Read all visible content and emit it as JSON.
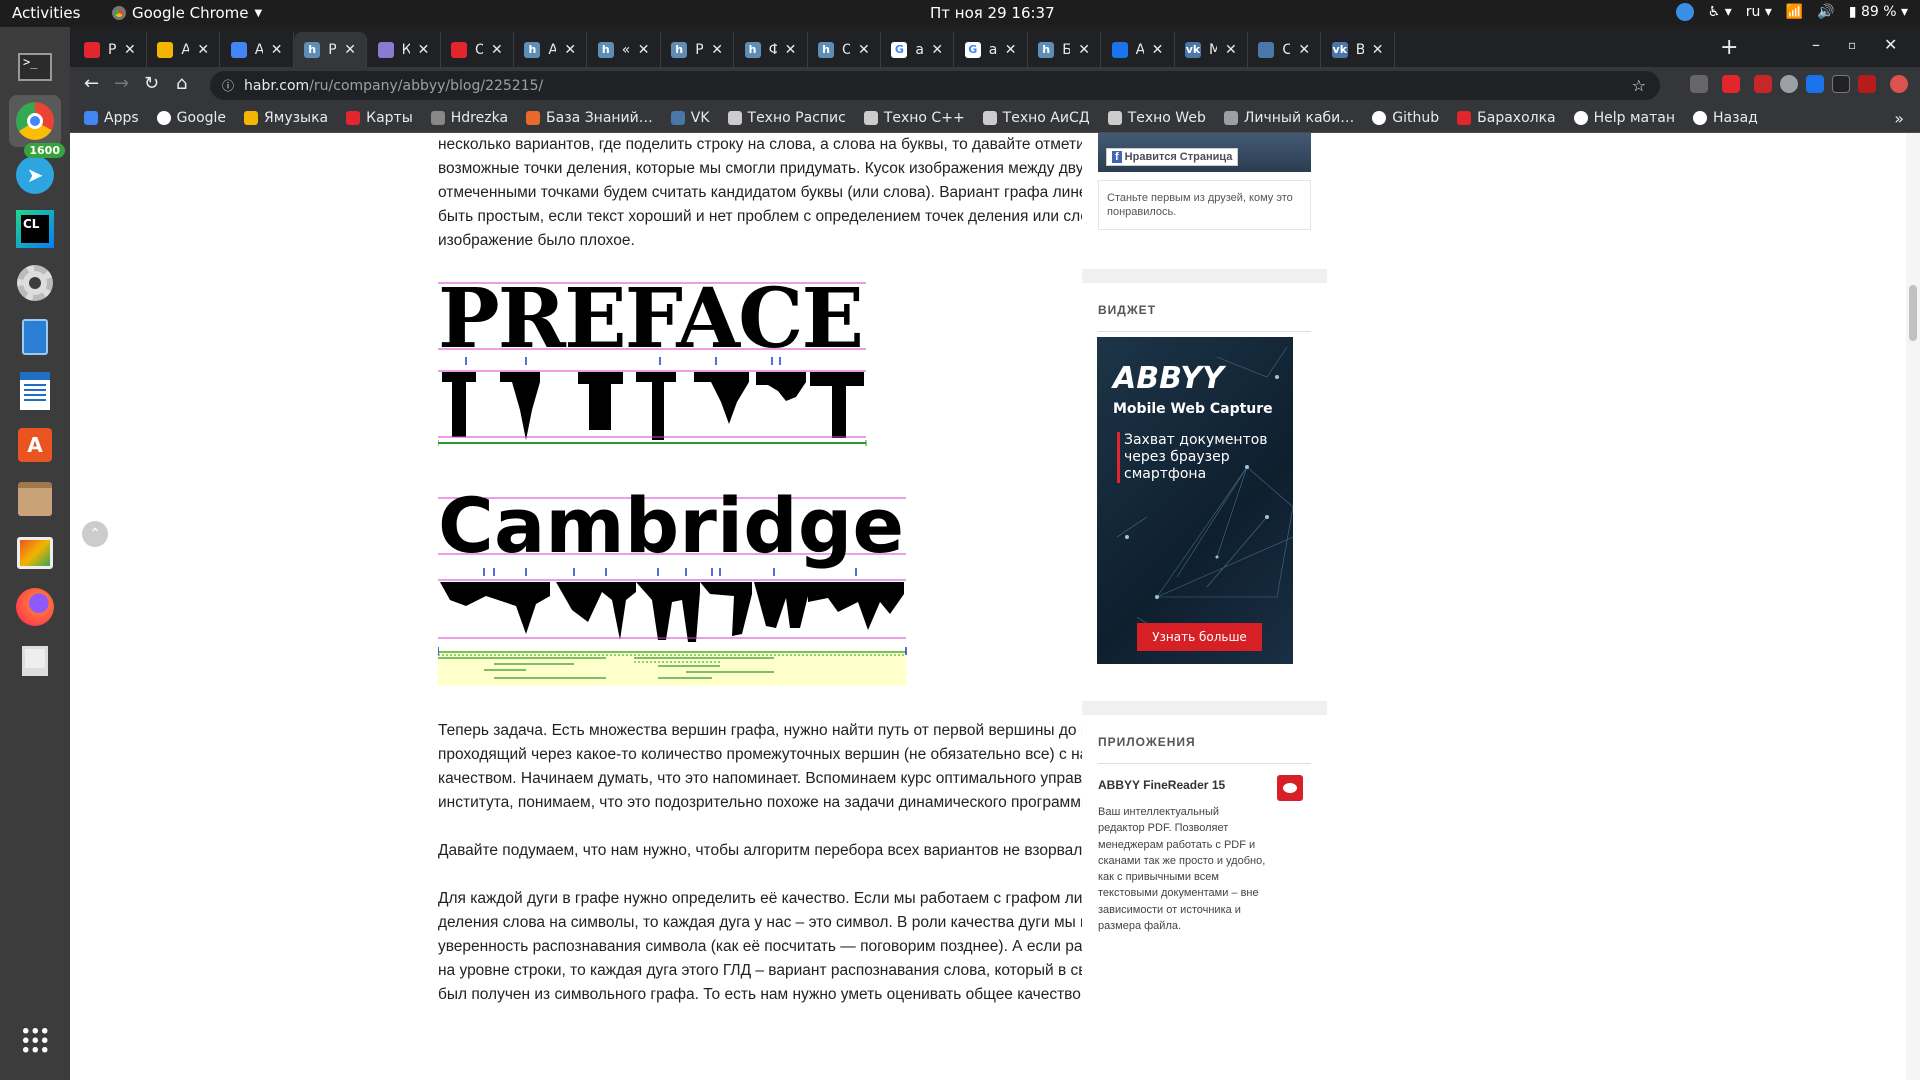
{
  "system": {
    "activities": "Activities",
    "app_name": "Google Chrome",
    "clock": "Пт ноя 29  16:37",
    "lang": "ru",
    "battery": "89 %"
  },
  "dock": {
    "telegram_badge": "1600"
  },
  "tabs": [
    {
      "label": "Рас",
      "fav": "#e3262e",
      "fav_text": ""
    },
    {
      "label": "Abb",
      "fav": "#f4b400",
      "fav_text": ""
    },
    {
      "label": "Abb",
      "fav": "#4285f4",
      "fav_text": ""
    },
    {
      "label": "Рас",
      "fav": "#5e8db5",
      "fav_text": "h"
    },
    {
      "label": "Как",
      "fav": "#8a7bd0",
      "fav_text": ""
    },
    {
      "label": "OCF",
      "fav": "#e3262e",
      "fav_text": ""
    },
    {
      "label": "Алг",
      "fav": "#5e8db5",
      "fav_text": "h"
    },
    {
      "label": "«За",
      "fav": "#5e8db5",
      "fav_text": "h"
    },
    {
      "label": "Рас",
      "fav": "#5e8db5",
      "fav_text": "h"
    },
    {
      "label": "Фор",
      "fav": "#5e8db5",
      "fav_text": "h"
    },
    {
      "label": "Обр",
      "fav": "#5e8db5",
      "fav_text": "h"
    },
    {
      "label": "авт",
      "fav": "#ffffff",
      "fav_text": "G"
    },
    {
      "label": "ада",
      "fav": "#ffffff",
      "fav_text": "G"
    },
    {
      "label": "Бин",
      "fav": "#5e8db5",
      "fav_text": "h"
    },
    {
      "label": "Ада",
      "fav": "#1a73e8",
      "fav_text": ""
    },
    {
      "label": "Ма",
      "fav": "#4a76a8",
      "fav_text": "vk"
    },
    {
      "label": "Соо",
      "fav": "#4a76a8",
      "fav_text": ""
    },
    {
      "label": "Все",
      "fav": "#4a76a8",
      "fav_text": "vk"
    }
  ],
  "omnibox": {
    "url_host": "habr.com",
    "url_path": "/ru/company/abbyy/blog/225215/"
  },
  "bookmarks": [
    {
      "label": "Apps",
      "color": "#4285f4"
    },
    {
      "label": "Google",
      "color": "#ffffff"
    },
    {
      "label": "Ямузыка",
      "color": "#f4b400"
    },
    {
      "label": "Карты",
      "color": "#e3262e"
    },
    {
      "label": "Hdrezka",
      "color": "#888888"
    },
    {
      "label": "База Знаний…",
      "color": "#e86a2b"
    },
    {
      "label": "VK",
      "color": "#4a76a8"
    },
    {
      "label": "Техно Распис",
      "color": "#cccccc"
    },
    {
      "label": "Техно C++",
      "color": "#cccccc"
    },
    {
      "label": "Техно АиСД",
      "color": "#cccccc"
    },
    {
      "label": "Техно Web",
      "color": "#cccccc"
    },
    {
      "label": "Личный каби…",
      "color": "#9aa0a6"
    },
    {
      "label": "Github",
      "color": "#ffffff"
    },
    {
      "label": "Барахолка",
      "color": "#e3262e"
    },
    {
      "label": "Help матан",
      "color": "#ffffff"
    },
    {
      "label": "Назад",
      "color": "#ffffff"
    }
  ],
  "article": {
    "p1": "несколько вариантов, где поделить строку на слова, а слова на буквы, то давайте отметим все возможные точки деления, которые мы смогли придумать. Кусок изображения между двумя отмеченными точками будем считать кандидатом буквы (или слова). Вариант графа линейного может быть простым, если текст хороший и нет проблем с определением точек деления или сложным, если изображение было плохое.",
    "fig1_word": "PREFACE",
    "fig2_word": "Cambridge",
    "p2": "Теперь задача. Есть множества вершин графа, нужно найти путь от первой вершины до последней, проходящий через какое-то количество промежуточных вершин (не обязательно все) с наилучшим качеством. Начинаем думать, что это напоминает. Вспоминаем курс оптимального управления из института, понимаем, что это подозрительно похоже на задачи динамического программирования.",
    "p3": "Давайте подумаем, что нам нужно, чтобы алгоритм перебора всех вариантов не взорвался.",
    "p4": "Для каждой дуги в графе нужно определить её качество. Если мы работаем с графом линейного деления слова на символы, то каждая дуга у нас – это символ. В роли качества дуги мы используем уверенность распознавания символа (как её посчитать — поговорим позднее). А если работаем с ГЛД на уровне строки, то каждая дуга этого ГЛД – вариант распознавания слова, который в свою очередь был получен из символьного графа. То есть нам нужно уметь оценивать общее качество полного пути в"
  },
  "sidebar": {
    "fb_like": "Нравится Страница",
    "fb_text": "Станьте первым из друзей, кому это понравилось.",
    "widget_title": "ВИДЖЕТ",
    "ad_brand": "ABBYY",
    "ad_sub": "Mobile Web Capture",
    "ad_desc": "Захват документов через браузер смартфона",
    "ad_button": "Узнать больше",
    "apps_title": "ПРИЛОЖЕНИЯ",
    "app_name": "ABBYY FineReader 15",
    "app_desc": "Ваш интеллектуальный редактор PDF. Позволяет менеджерам работать с PDF и сканами так же просто и удобно, как с привычными всем текстовыми документами – вне зависимости от источника и размера файла."
  }
}
